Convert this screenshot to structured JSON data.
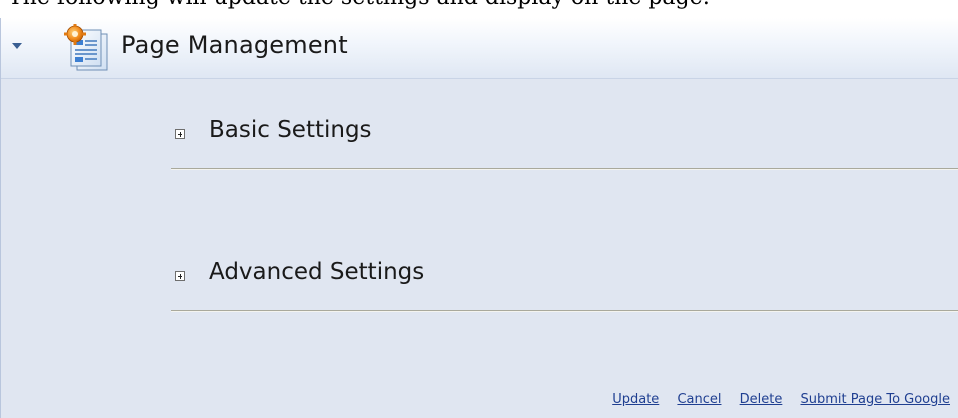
{
  "header": {
    "title": "Page Management"
  },
  "sections": [
    {
      "label": "Basic Settings"
    },
    {
      "label": "Advanced Settings"
    }
  ],
  "actions": {
    "update": "Update",
    "cancel": "Cancel",
    "delete": "Delete",
    "submit": "Submit Page To Google"
  },
  "clipped_top_text": "The following will update the settings and display on the page:",
  "colors": {
    "panel_background": "#e0e6f1",
    "link": "#1f3f91",
    "collapse_arrow": "#3a5f93"
  }
}
